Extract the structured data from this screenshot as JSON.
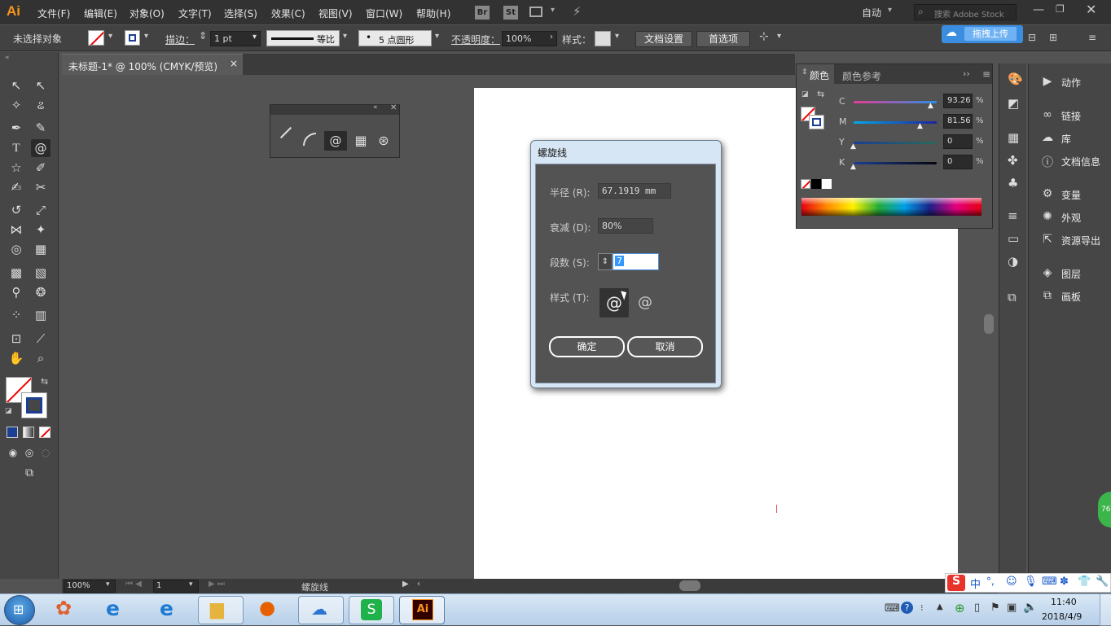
{
  "menubar": {
    "logo": "Ai",
    "items": [
      "文件(F)",
      "编辑(E)",
      "对象(O)",
      "文字(T)",
      "选择(S)",
      "效果(C)",
      "视图(V)",
      "窗口(W)",
      "帮助(H)"
    ],
    "br": "Br",
    "st": "St",
    "workspace": "自动",
    "search_placeholder": "搜索 Adobe Stock"
  },
  "control": {
    "no_selection": "未选择对象",
    "stroke_label": "描边：",
    "stroke_value": "1 pt",
    "profile": "等比",
    "brush": "5 点圆形",
    "opacity_label": "不透明度：",
    "opacity_value": "100%",
    "style_label": "样式：",
    "doc_setup": "文档设置",
    "prefs": "首选项",
    "upload": "拖拽上传"
  },
  "document": {
    "tab_title": "未标题-1* @ 100% (CMYK/预览)",
    "tab_close": "×"
  },
  "dialog": {
    "title": "螺旋线",
    "radius_label": "半径 (R):",
    "radius_value": "67.1919 mm",
    "decay_label": "衰减 (D):",
    "decay_value": "80%",
    "segments_label": "段数 (S):",
    "segments_value": "7",
    "style_label": "样式 (T):",
    "ok": "确定",
    "cancel": "取消"
  },
  "color_panel": {
    "tab_color": "颜色",
    "tab_guide": "颜色参考",
    "channels": [
      {
        "name": "C",
        "value": "93.26",
        "level": 0.93
      },
      {
        "name": "M",
        "value": "81.56",
        "level": 0.82
      },
      {
        "name": "Y",
        "value": "0",
        "level": 0
      },
      {
        "name": "K",
        "value": "0",
        "level": 0
      }
    ],
    "unit": "%"
  },
  "right_panels": [
    "动作",
    "链接",
    "库",
    "文档信息",
    "变量",
    "外观",
    "资源导出",
    "图层",
    "画板"
  ],
  "status": {
    "zoom": "100%",
    "page": "1",
    "tool_name": "螺旋线"
  },
  "taskbar": {
    "ime": "中",
    "time": "11:40",
    "date": "2018/4/9",
    "badge": "76"
  },
  "colors": {
    "accent_fill": "#1c3f94",
    "ai_orange": "#f7941e"
  }
}
